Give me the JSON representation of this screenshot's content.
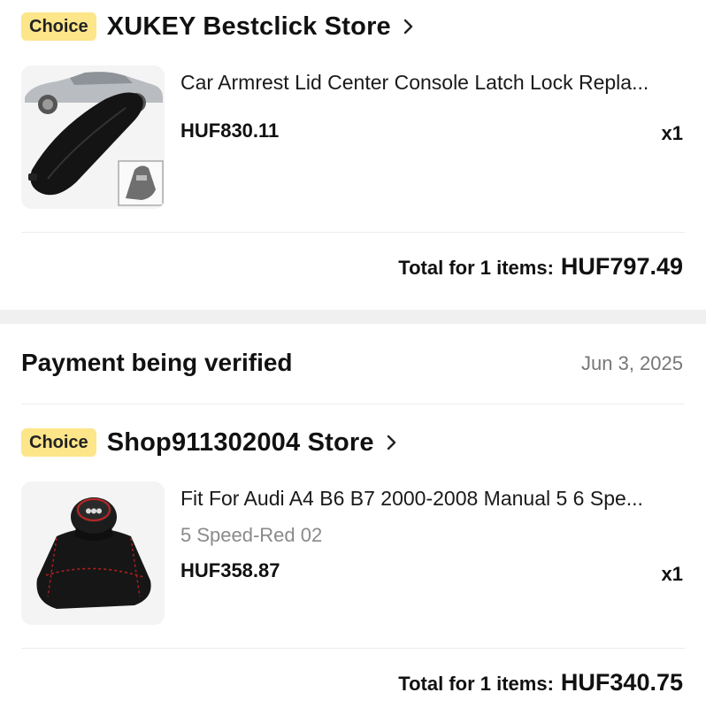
{
  "order1": {
    "badge": "Choice",
    "store_name": "XUKEY Bestclick Store",
    "product": {
      "title": "Car Armrest Lid Center Console Latch Lock Repla...",
      "price": "HUF830.11",
      "quantity": "x1",
      "image_icon": "armrest-lid-product-image"
    },
    "total_label": "Total for 1 items:",
    "total_value": "HUF797.49"
  },
  "order2": {
    "status": "Payment being verified",
    "date": "Jun 3, 2025",
    "badge": "Choice",
    "store_name": "Shop911302004 Store",
    "product": {
      "title": "Fit For Audi A4 B6 B7 2000-2008 Manual 5 6 Spe...",
      "variant": "5 Speed-Red 02",
      "price": "HUF358.87",
      "quantity": "x1",
      "image_icon": "gear-shift-knob-product-image"
    },
    "total_label": "Total for 1 items:",
    "total_value": "HUF340.75"
  },
  "colors": {
    "choice_badge_bg": "#fde58a",
    "section_gap": "#f0f0f0",
    "muted_text": "#8a8a8a"
  }
}
